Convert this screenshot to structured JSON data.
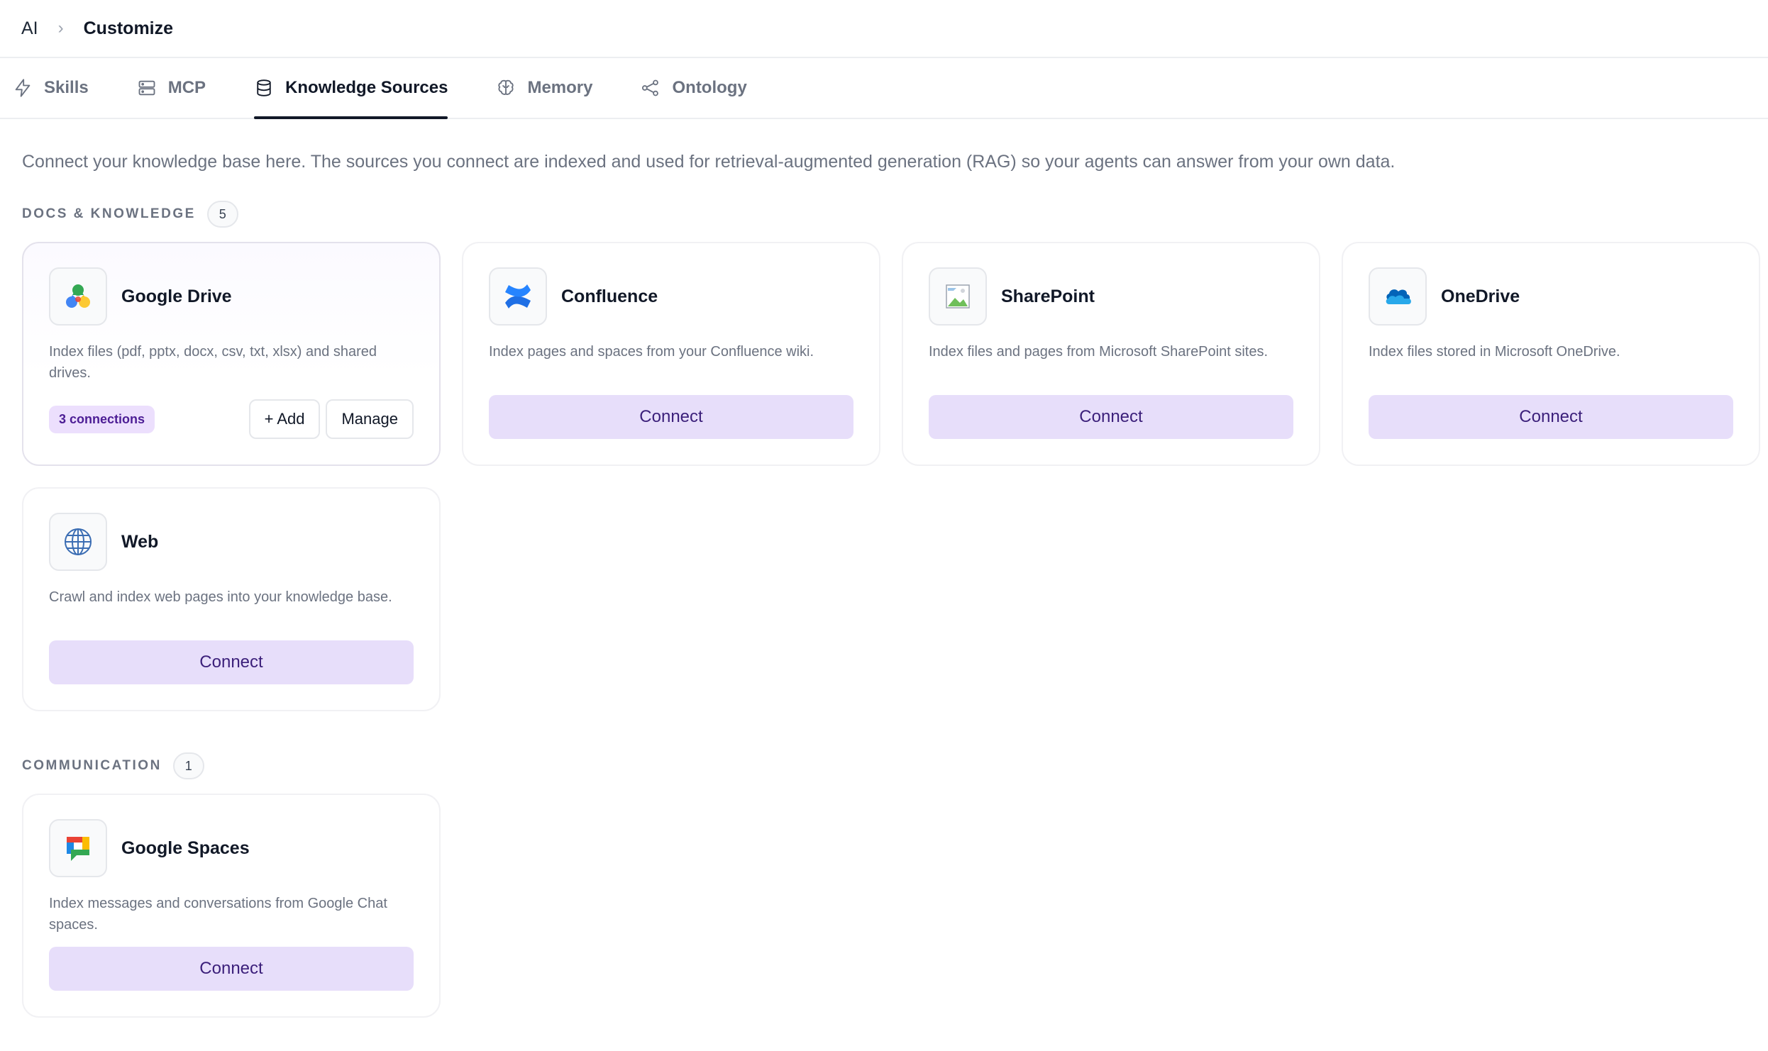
{
  "breadcrumb": {
    "root": "AI",
    "separator": "›",
    "current": "Customize"
  },
  "tabs": [
    {
      "label": "Skills",
      "icon": "lightning-icon"
    },
    {
      "label": "MCP",
      "icon": "server-icon"
    },
    {
      "label": "Knowledge Sources",
      "icon": "database-icon",
      "active": true
    },
    {
      "label": "Memory",
      "icon": "brain-icon"
    },
    {
      "label": "Ontology",
      "icon": "graph-icon"
    }
  ],
  "intro": "Connect your knowledge base here. The sources you connect are indexed and used for retrieval-augmented generation (RAG) so your agents can answer from your own data.",
  "docs_section": {
    "title": "DOCS & KNOWLEDGE",
    "count": "5",
    "cards": [
      {
        "name": "Google Drive",
        "icon": "google-drive-icon",
        "description": "Index files (pdf, pptx, docx, csv, txt, xlsx) and shared drives.",
        "connections": "3 connections",
        "add_label": "+ Add",
        "manage_label": "Manage"
      },
      {
        "name": "Confluence",
        "icon": "confluence-icon",
        "description": "Index pages and spaces from your Confluence wiki.",
        "connect_label": "Connect"
      },
      {
        "name": "SharePoint",
        "icon": "broken-image-icon",
        "description": "Index files and pages from Microsoft SharePoint sites.",
        "connect_label": "Connect"
      },
      {
        "name": "OneDrive",
        "icon": "onedrive-cloud-icon",
        "description": "Index files stored in Microsoft OneDrive.",
        "connect_label": "Connect"
      },
      {
        "name": "Web",
        "icon": "globe-icon",
        "description": "Crawl and index web pages into your knowledge base.",
        "connect_label": "Connect"
      }
    ]
  },
  "comm_section": {
    "title": "COMMUNICATION",
    "count": "1",
    "cards": [
      {
        "name": "Google Spaces",
        "icon": "google-chat-icon",
        "description": "Index messages and conversations from Google Chat spaces.",
        "connect_label": "Connect"
      }
    ]
  },
  "colors": {
    "accent_bg": "#e7defa",
    "accent_text": "#3b1f7a",
    "muted_text": "#6b7280"
  }
}
